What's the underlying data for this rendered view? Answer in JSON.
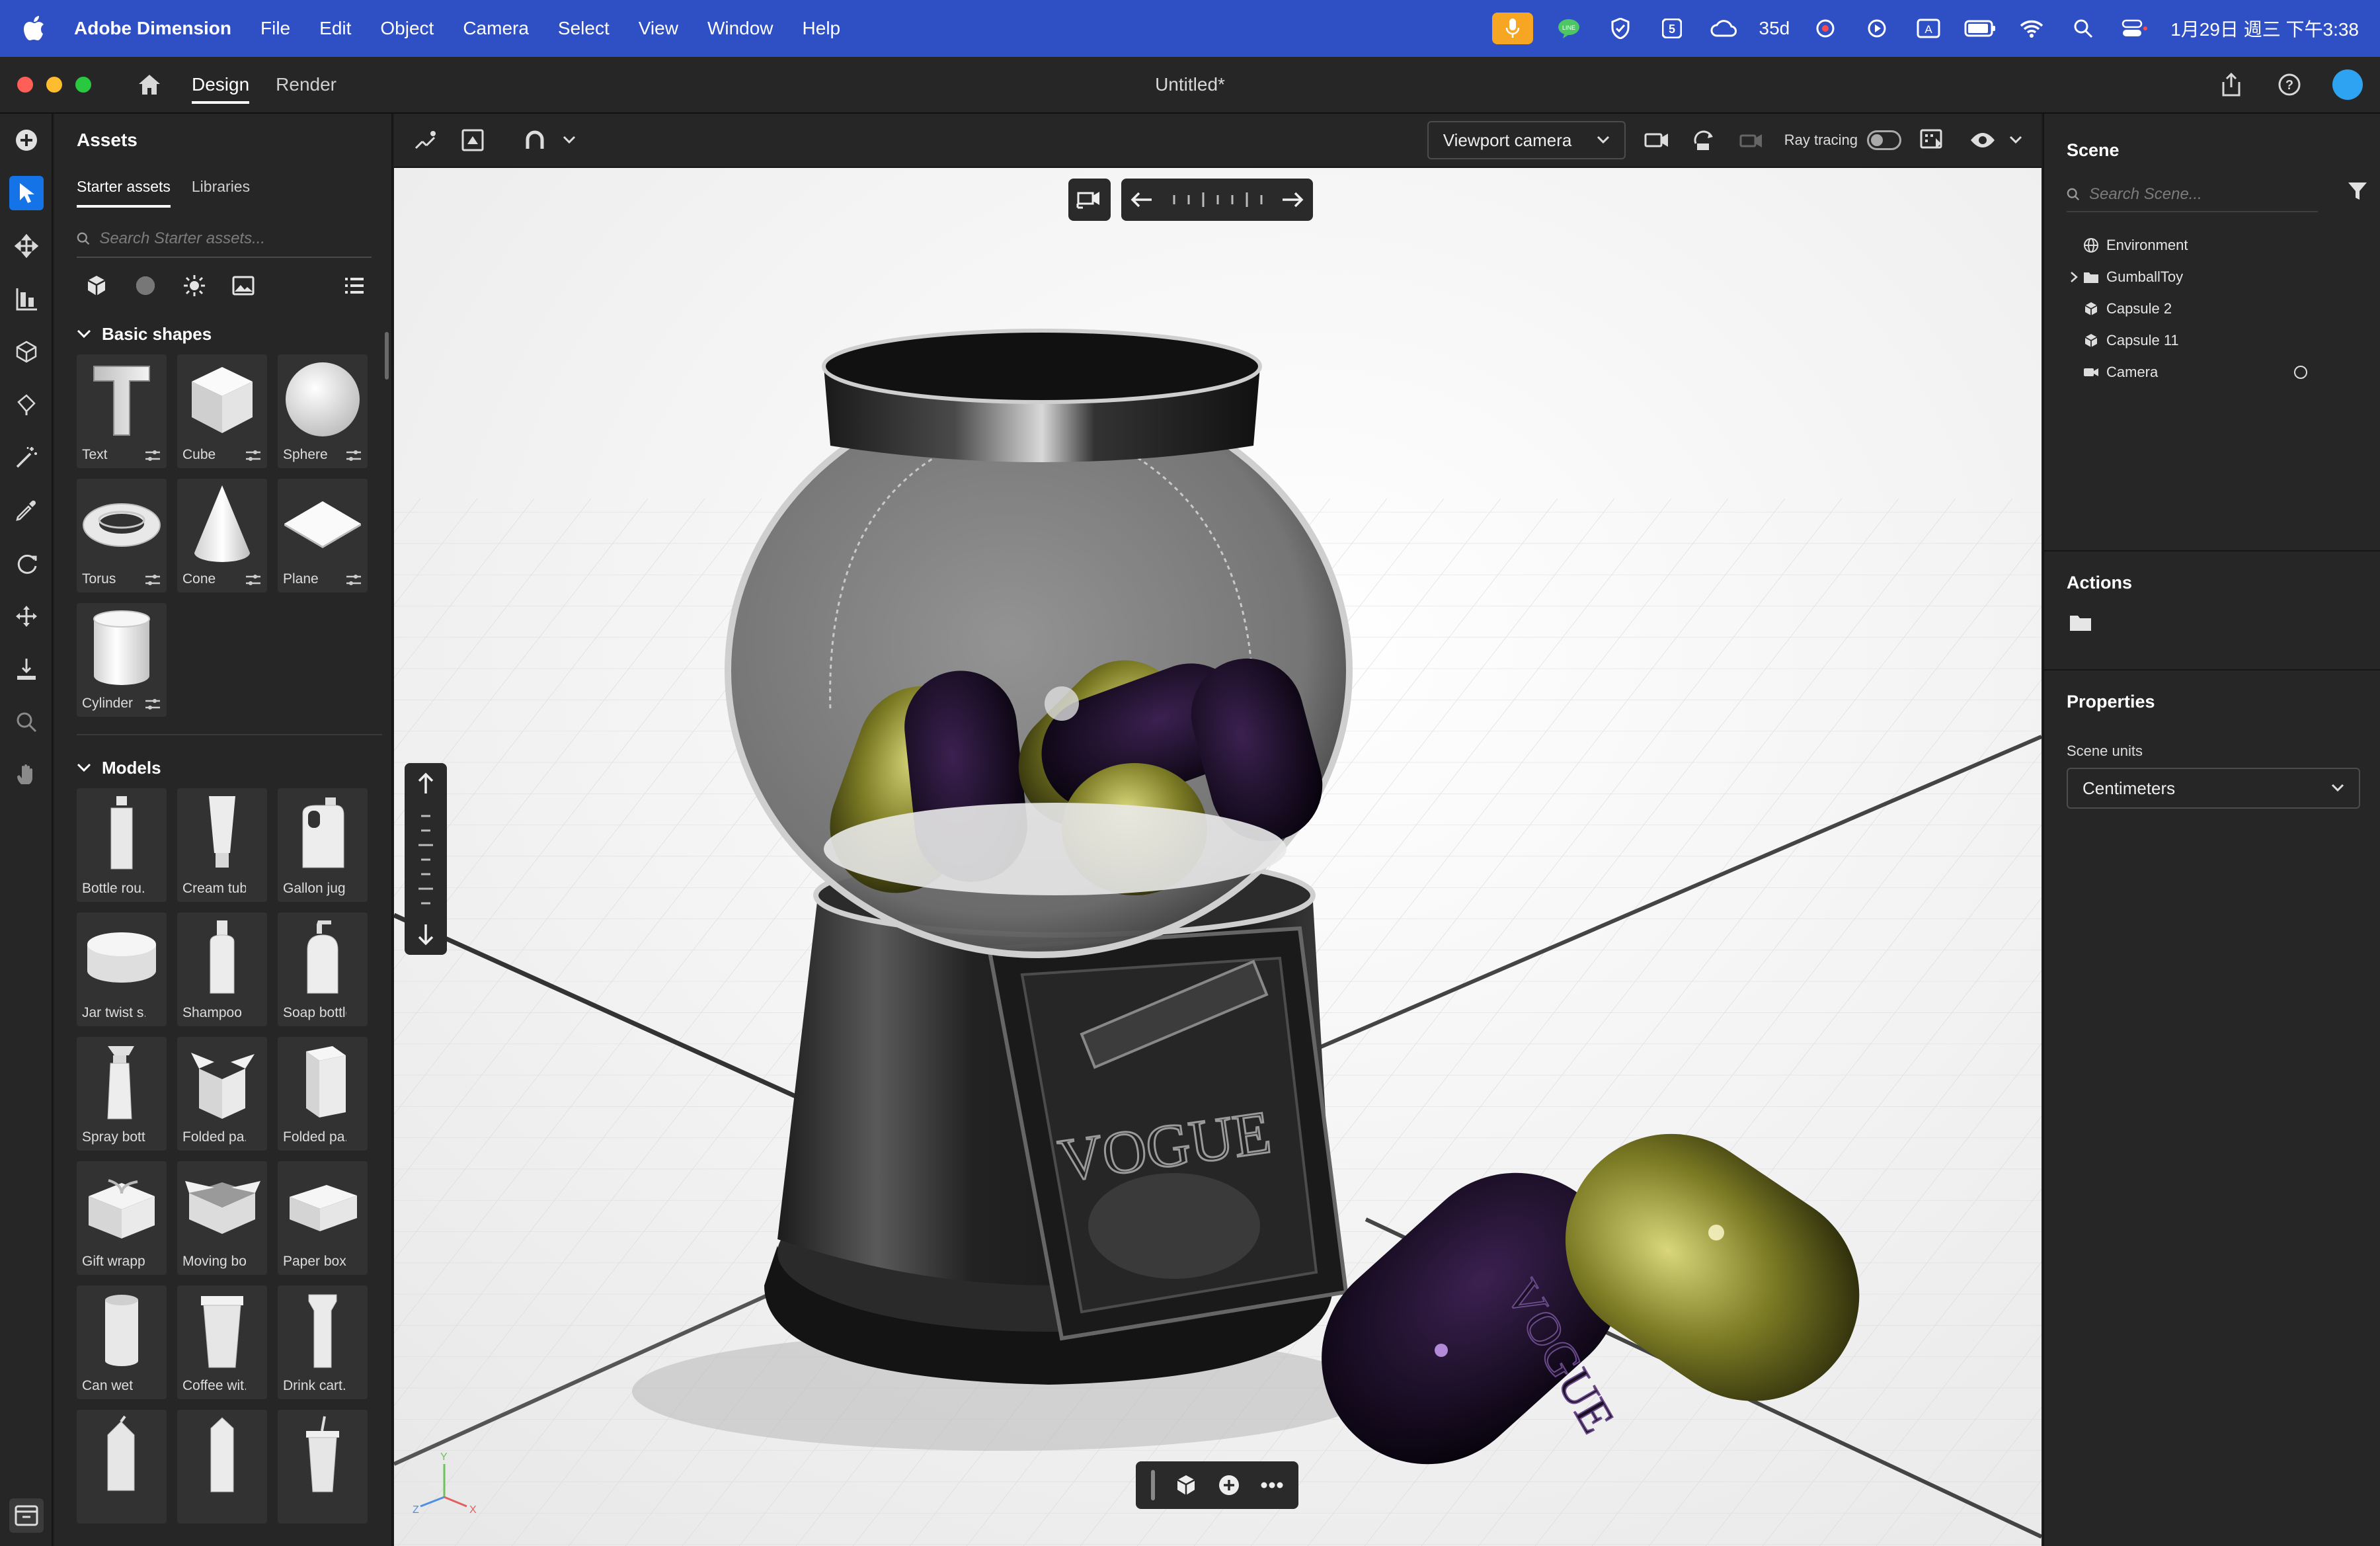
{
  "menubar": {
    "app_name": "Adobe Dimension",
    "menus": [
      "File",
      "Edit",
      "Object",
      "Camera",
      "Select",
      "View",
      "Window",
      "Help"
    ],
    "status_text": "35d",
    "clock": "1月29日 週三 下午3:38"
  },
  "window": {
    "modes": [
      "Design",
      "Render"
    ],
    "active_mode": "Design",
    "document_title": "Untitled*"
  },
  "assets": {
    "title": "Assets",
    "tabs": [
      "Starter assets",
      "Libraries"
    ],
    "search_placeholder": "Search Starter assets...",
    "basic_shapes": {
      "title": "Basic shapes",
      "items": [
        "Text",
        "Cube",
        "Sphere",
        "Torus",
        "Cone",
        "Plane",
        "Cylinder"
      ]
    },
    "models": {
      "title": "Models",
      "items": [
        "Bottle rou...",
        "Cream tube",
        "Gallon jug",
        "Jar twist s...",
        "Shampoo ...",
        "Soap bottle",
        "Spray bott...",
        "Folded pa...",
        "Folded pa...",
        "Gift wrapp...",
        "Moving bo...",
        "Paper box ...",
        "Can wet",
        "Coffee wit...",
        "Drink cart...",
        "",
        "",
        ""
      ]
    }
  },
  "viewport": {
    "camera_select": "Viewport camera",
    "ray_tracing_label": "Ray tracing",
    "ray_tracing_on": false,
    "jar_label": "VOGUE",
    "capsule_label": "VOGUE",
    "axis_labels": {
      "y": "Y",
      "x": "X",
      "z": "Z"
    }
  },
  "scene": {
    "title": "Scene",
    "search_placeholder": "Search Scene...",
    "items": [
      {
        "name": "Environment",
        "icon": "globe-icon",
        "expandable": false
      },
      {
        "name": "GumballToy",
        "icon": "folder-icon",
        "expandable": true
      },
      {
        "name": "Capsule 2",
        "icon": "cube-icon",
        "expandable": false
      },
      {
        "name": "Capsule 11",
        "icon": "cube-icon",
        "expandable": false
      },
      {
        "name": "Camera",
        "icon": "camera-icon",
        "expandable": false
      }
    ]
  },
  "actions": {
    "title": "Actions"
  },
  "properties": {
    "title": "Properties",
    "scene_units_label": "Scene units",
    "scene_units_value": "Centimeters"
  }
}
